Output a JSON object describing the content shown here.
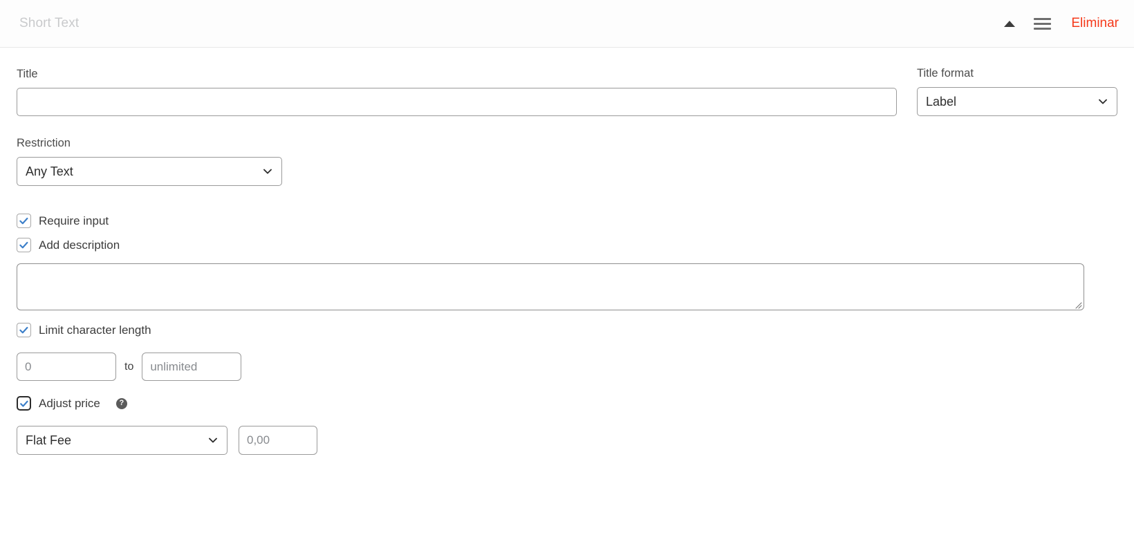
{
  "header": {
    "title": "Short Text",
    "collapse_icon": "triangle-up-icon",
    "menu_icon": "hamburger-menu-icon",
    "delete_label": "Eliminar",
    "delete_color": "#f5391a"
  },
  "form": {
    "title_field": {
      "label": "Title",
      "value": "",
      "placeholder": ""
    },
    "title_format": {
      "label": "Title format",
      "selected": "Label"
    },
    "restriction": {
      "label": "Restriction",
      "selected": "Any Text"
    },
    "require_input": {
      "label": "Require input",
      "checked": true
    },
    "add_description": {
      "label": "Add description",
      "checked": true
    },
    "description": {
      "value": "",
      "placeholder": ""
    },
    "limit_character_length": {
      "label": "Limit character length",
      "checked": true
    },
    "length_min": {
      "value": "",
      "placeholder": "0"
    },
    "length_separator": "to",
    "length_max": {
      "value": "",
      "placeholder": "unlimited"
    },
    "adjust_price": {
      "label": "Adjust price",
      "checked": true,
      "help_icon": "question-mark-icon"
    },
    "price_type": {
      "selected": "Flat Fee"
    },
    "price_amount": {
      "value": "",
      "placeholder": "0,00"
    }
  },
  "theme": {
    "checkbox_check": "#3c7fc9",
    "border": "#9a9a9a",
    "text": "#3c3c3c"
  }
}
